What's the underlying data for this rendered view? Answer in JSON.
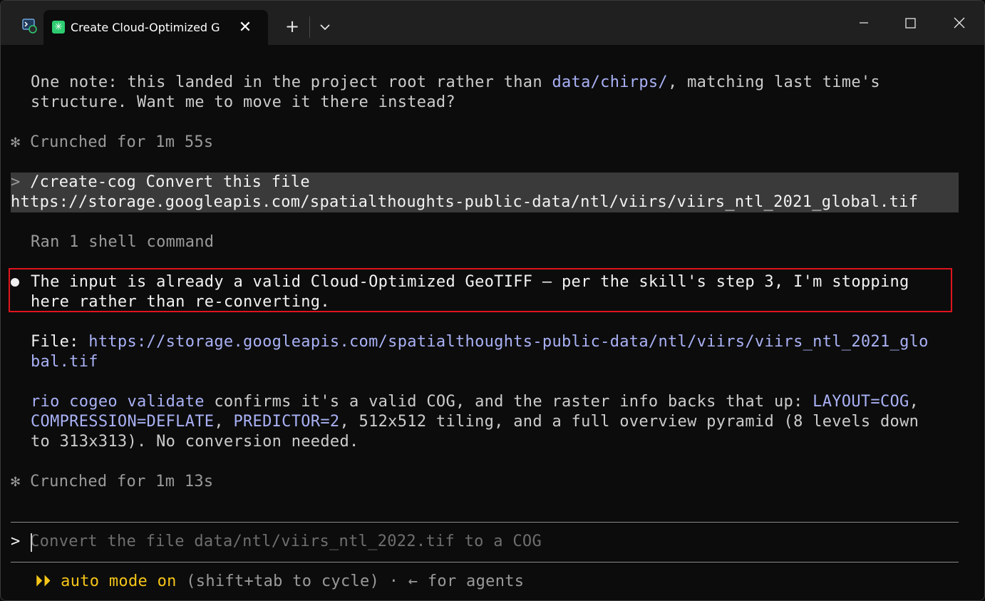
{
  "window": {
    "tab_title": "Create Cloud-Optimized G",
    "tab_icon": "✳",
    "new_tab": "+",
    "dropdown": "⌄"
  },
  "terminal": {
    "note_line1": {
      "a": "One note: this landed in the project root rather than ",
      "b": "data/chirps/",
      "c": ", matching last time's"
    },
    "note_line2": "structure. Want me to move it there instead?",
    "crunched1": {
      "icon": "✻",
      "text": "Crunched for 1m 55s"
    },
    "user_prompt": {
      "marker": ">",
      "line1": "/create-cog Convert this file",
      "line2": "https://storage.googleapis.com/spatialthoughts-public-data/ntl/viirs/viirs_ntl_2021_global.tif"
    },
    "ran_shell": "Ran 1 shell command",
    "result_line1": "The input is already a valid Cloud-Optimized GeoTIFF — per the skill's step 3, I'm stopping",
    "result_line2": "here rather than re-converting.",
    "file_label": "File: ",
    "file_url1": "https://storage.googleapis.com/spatialthoughts-public-data/ntl/viirs/viirs_ntl_2021_glo",
    "file_url2": "bal.tif",
    "info_line1": {
      "cmd": "rio cogeo validate",
      "text": " confirms it's a valid COG, and the raster info backs that up: ",
      "layout": "LAYOUT=COG",
      "tail": ","
    },
    "info_line2": {
      "compression": "COMPRESSION=DEFLATE",
      "sep": ", ",
      "predictor": "PREDICTOR=2",
      "text": ", 512x512 tiling, and a full overview pyramid (8 levels down"
    },
    "info_line3": "to 313x313). No conversion needed.",
    "crunched2": {
      "icon": "✻",
      "text": "Crunched for 1m 13s"
    },
    "input": {
      "marker": ">",
      "placeholder": "Convert the file data/ntl/viirs_ntl_2022.tif to a COG"
    },
    "status": {
      "icon": "⏵⏵",
      "mode": "auto mode on",
      "rest": " (shift+tab to cycle) · ← for agents"
    }
  },
  "colors": {
    "link": "#a9b1f5",
    "highlight_border": "#e0141e",
    "auto_mode": "#f5c518",
    "background": "#0c0c0c"
  }
}
